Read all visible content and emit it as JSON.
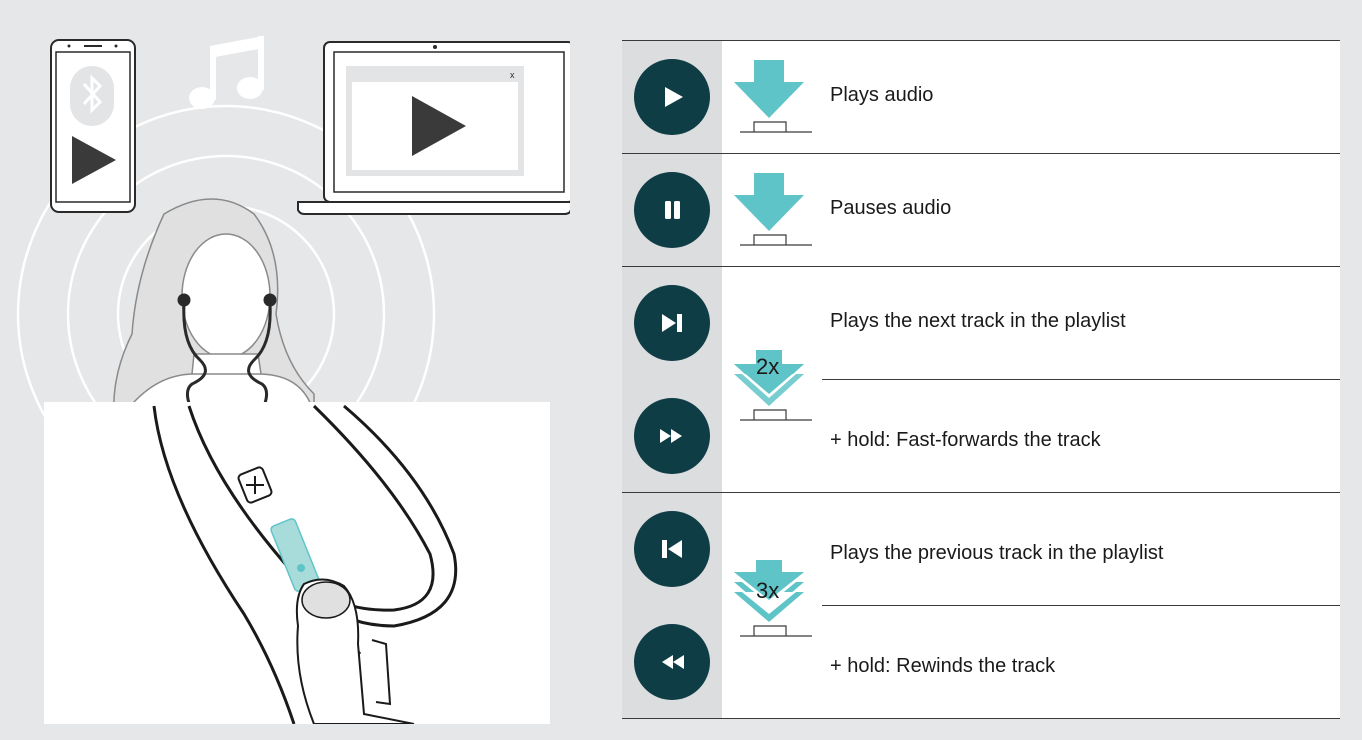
{
  "illustration": {
    "laptop_close": "x"
  },
  "rows": [
    {
      "icon": "play-icon",
      "label": "Plays audio",
      "press_count": ""
    },
    {
      "icon": "pause-icon",
      "label": "Pauses audio",
      "press_count": ""
    },
    {
      "icon": "next-track-icon",
      "label": "Plays the next track in the playlist",
      "press_count": "2x"
    },
    {
      "icon": "fast-forward-icon",
      "label": "+ hold: Fast-forwards the track",
      "press_count": ""
    },
    {
      "icon": "previous-track-icon",
      "label": "Plays the previous track in the playlist",
      "press_count": "3x"
    },
    {
      "icon": "rewind-icon",
      "label": "+ hold: Rewinds the track",
      "press_count": ""
    }
  ],
  "colors": {
    "button_dark": "#0f3d45",
    "arrow_teal": "#5fc4c8",
    "highlight_teal": "#a8dcda",
    "background": "#e6e7e8"
  }
}
